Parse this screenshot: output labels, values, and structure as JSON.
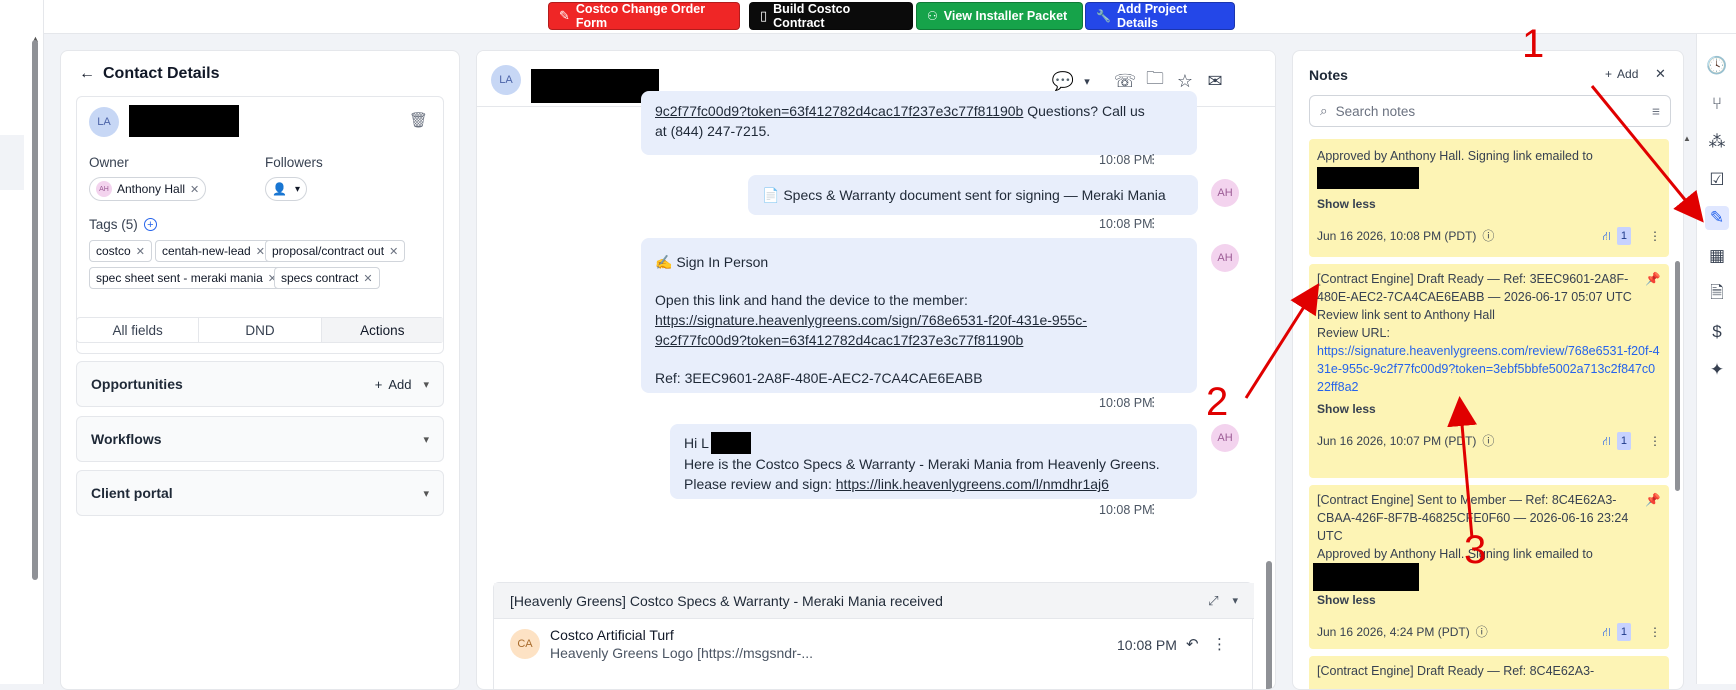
{
  "toolbar": {
    "buttons": [
      {
        "label": "Costco Change Order Form",
        "color": "#ef2626"
      },
      {
        "label": "Build Costco Contract",
        "color": "#0b0b0b"
      },
      {
        "label": "View Installer Packet",
        "color": "#16a34a"
      },
      {
        "label": "Add Project Details",
        "color": "#2447e8"
      }
    ]
  },
  "contact": {
    "title": "Contact Details",
    "initials": "LA",
    "owner_label": "Owner",
    "followers_label": "Followers",
    "owner_initials": "AH",
    "owner_name": "Anthony Hall",
    "tags_label": "Tags (5)",
    "tags": [
      "costco",
      "centah-new-lead",
      "proposal/contract out",
      "spec sheet sent - meraki mania",
      "specs contract"
    ],
    "tabs": [
      "All fields",
      "DND",
      "Actions"
    ],
    "sections": [
      {
        "label": "Opportunities",
        "add_label": "Add"
      },
      {
        "label": "Workflows"
      },
      {
        "label": "Client portal"
      }
    ]
  },
  "conversation": {
    "header_initials": "LA",
    "messages": [
      {
        "link": "9c2f77fc00d9?token=63f412782d4cac17f237e3c77f81190b",
        "text_after": " Questions? Call us",
        "line2": "at (844) 247-7215.",
        "time": "10:08 PM"
      },
      {
        "text": "📄 Specs & Warranty document sent for signing — Meraki Mania",
        "time": "10:08 PM",
        "avatar": "AH"
      },
      {
        "title": "✍️ Sign In Person",
        "body": "Open this link and hand the device to the member:",
        "link1": "https://signature.heavenlygreens.com/sign/768e6531-f20f-431e-955c-",
        "link2": "9c2f77fc00d9?token=63f412782d4cac17f237e3c77f81190b",
        "ref": "Ref: 3EEC9601-2A8F-480E-AEC2-7CA4CAE6EABB",
        "time": "10:08 PM",
        "avatar": "AH"
      },
      {
        "greeting": "Hi L",
        "line1": "Here is the Costco Specs & Warranty - Meraki Mania from Heavenly Greens.",
        "line2_prefix": "Please review and sign: ",
        "link": "https://link.heavenlygreens.com/l/nmdhr1aj6",
        "time": "10:08 PM",
        "avatar": "AH"
      }
    ],
    "email": {
      "subject": "[Heavenly Greens] Costco Specs & Warranty - Meraki Mania received",
      "sender": "Costco Artificial Turf",
      "sender_initials": "CA",
      "preview": "Heavenly Greens Logo [https://msgsndr-...",
      "time": "10:08 PM"
    }
  },
  "notes": {
    "title": "Notes",
    "add_label": "Add",
    "search_placeholder": "Search notes",
    "items": [
      {
        "text": "Approved by Anthony Hall. Signing link emailed to",
        "show_less": "Show less",
        "date": "Jun 16 2026, 10:08 PM (PDT)",
        "count": "1"
      },
      {
        "text": "[Contract Engine] Draft Ready — Ref: 3EEC9601-2A8F-480E-AEC2-7CA4CAE6EABB — 2026-06-17 05:07 UTC",
        "line2": "Review link sent to Anthony Hall",
        "line3": "Review URL:",
        "url": "https://signature.heavenlygreens.com/review/768e6531-f20f-431e-955c-9c2f77fc00d9?token=3ebf5bbfe5002a713c2f847c022ff8a2",
        "show_less": "Show less",
        "date": "Jun 16 2026, 10:07 PM (PDT)",
        "count": "1"
      },
      {
        "text": "[Contract Engine] Sent to Member — Ref: 8C4E62A3-CBAA-426F-8F7B-46825CFE0F60 — 2026-06-16 23:24 UTC",
        "line2": "Approved by Anthony Hall. Signing link emailed to",
        "show_less": "Show less",
        "date": "Jun 16 2026, 4:24 PM (PDT)",
        "count": "1"
      },
      {
        "text": "[Contract Engine] Draft Ready — Ref: 8C4E62A3-"
      }
    ]
  },
  "annotations": {
    "one": "1",
    "two": "2",
    "three": "3"
  }
}
